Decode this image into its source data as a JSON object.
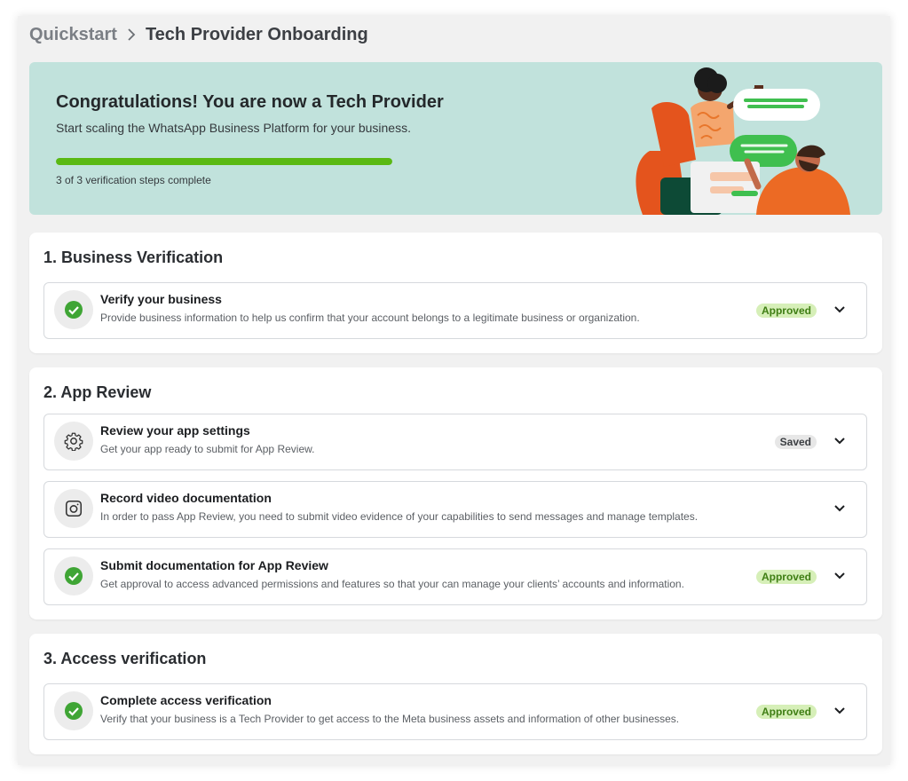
{
  "breadcrumb": {
    "root": "Quickstart",
    "current": "Tech Provider Onboarding"
  },
  "banner": {
    "title": "Congratulations! You are now a Tech Provider",
    "subtitle": "Start scaling the WhatsApp Business Platform for your business.",
    "progress_fraction": 1.0,
    "progress_text": "3 of 3 verification steps complete"
  },
  "sections": [
    {
      "title": "1. Business Verification",
      "items": [
        {
          "title": "Verify your business",
          "description": "Provide business information to help us confirm that your account belongs to a legitimate business or organization.",
          "status": "Approved",
          "icon": "check-circle-icon"
        }
      ]
    },
    {
      "title": "2. App Review",
      "items": [
        {
          "title": "Review your app settings",
          "description": "Get your app ready to submit for App Review.",
          "status": "Saved",
          "icon": "gear-icon"
        },
        {
          "title": "Record video documentation",
          "description": "In order to pass App Review, you need to submit video evidence of your capabilities to send messages and manage templates.",
          "status": "",
          "icon": "camera-icon"
        },
        {
          "title": "Submit documentation for App Review",
          "description": "Get approval to access advanced permissions and features so that your can manage your clients’ accounts and information.",
          "status": "Approved",
          "icon": "check-circle-icon"
        }
      ]
    },
    {
      "title": "3. Access verification",
      "items": [
        {
          "title": "Complete access verification",
          "description": "Verify that your business is a Tech Provider to get access to the Meta business assets and information of other businesses.",
          "status": "Approved",
          "icon": "check-circle-icon"
        }
      ]
    }
  ],
  "colors": {
    "accent_green": "#5ab913",
    "banner_bg": "#c1e2dc",
    "approved_bg": "#d6efb8",
    "approved_text": "#3f7e14"
  }
}
